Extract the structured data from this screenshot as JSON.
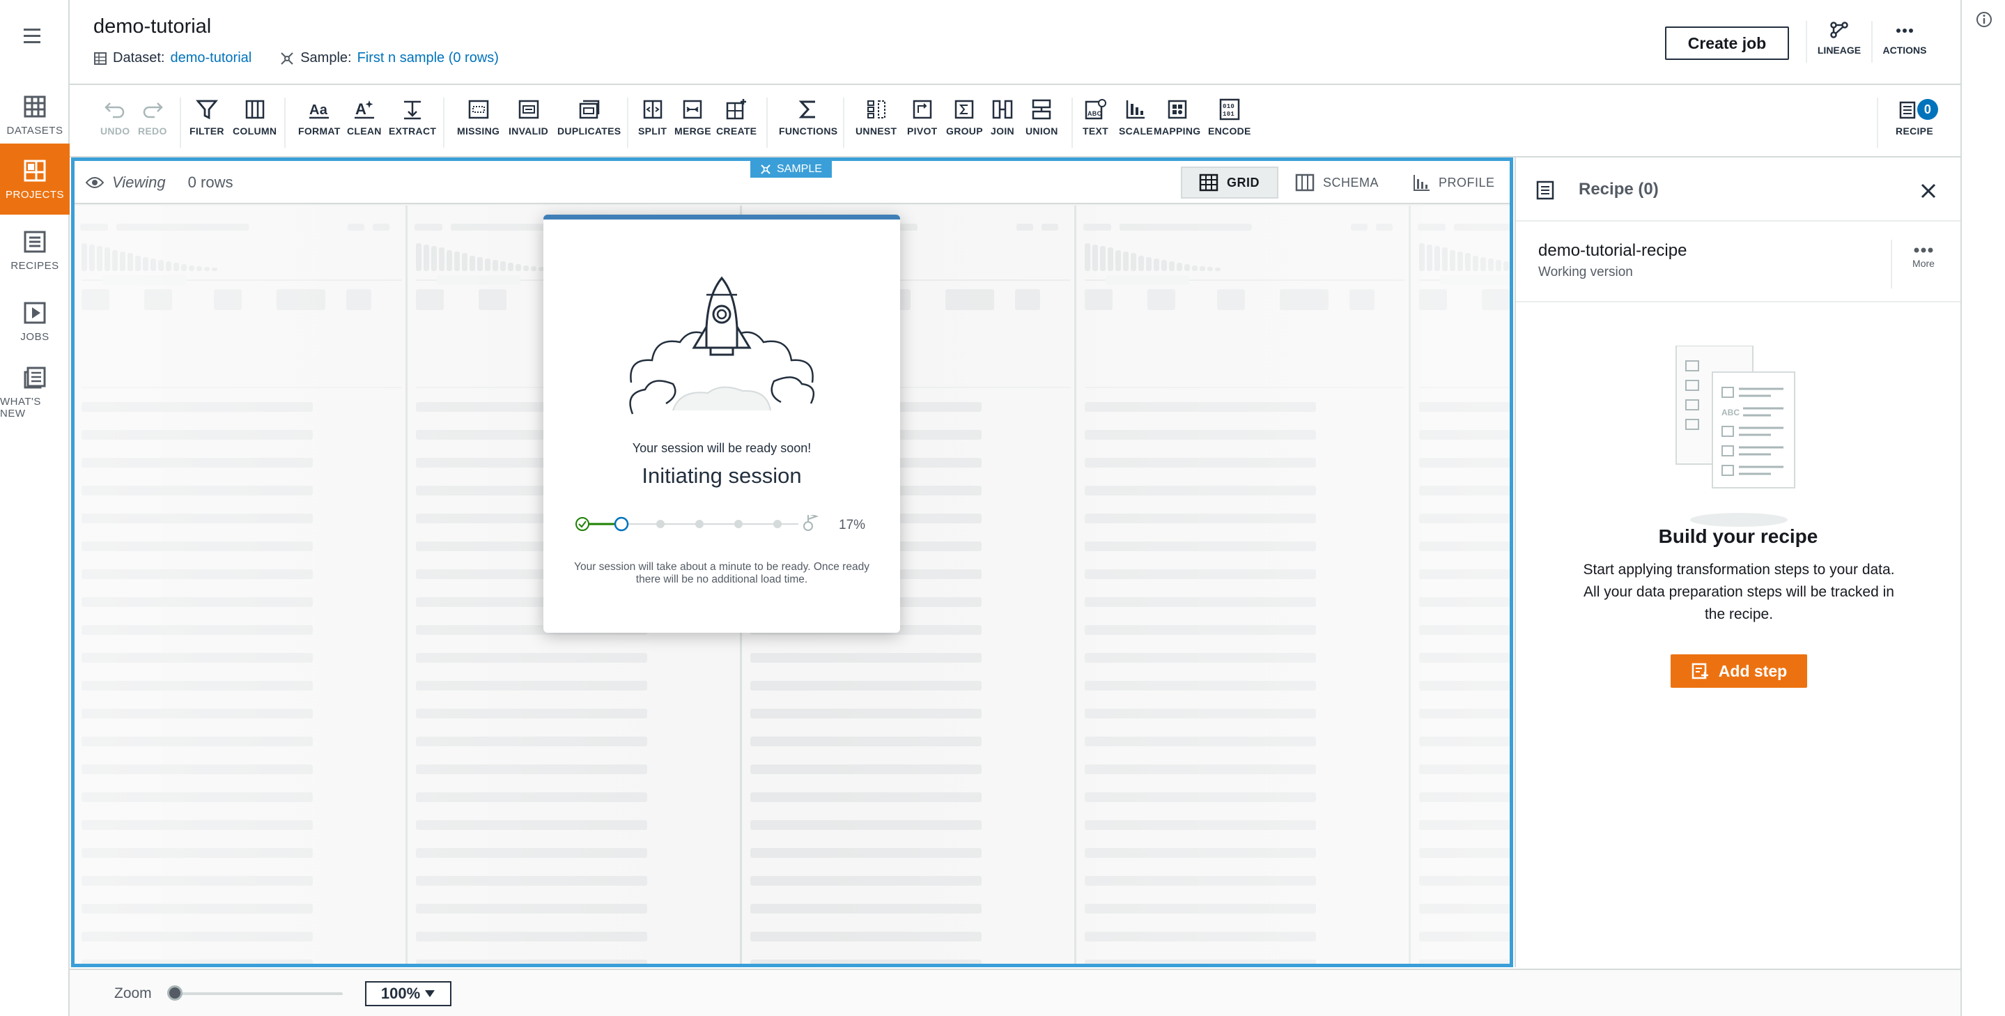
{
  "left_nav": {
    "items": [
      {
        "label": "DATASETS",
        "icon": "table-icon",
        "active": false
      },
      {
        "label": "PROJECTS",
        "icon": "grid-icon",
        "active": true
      },
      {
        "label": "RECIPES",
        "icon": "list-icon",
        "active": false
      },
      {
        "label": "JOBS",
        "icon": "play-icon",
        "active": false
      },
      {
        "label": "WHAT'S NEW",
        "icon": "news-icon",
        "active": false
      }
    ]
  },
  "header": {
    "title": "demo-tutorial",
    "dataset_label": "Dataset:",
    "dataset_value": "demo-tutorial",
    "sample_label": "Sample:",
    "sample_value": "First n sample (0 rows)",
    "create_job": "Create job",
    "lineage": "LINEAGE",
    "actions": "ACTIONS"
  },
  "toolbar": {
    "undo": "UNDO",
    "redo": "REDO",
    "filter": "FILTER",
    "column": "COLUMN",
    "format": "FORMAT",
    "clean": "CLEAN",
    "extract": "EXTRACT",
    "missing": "MISSING",
    "invalid": "INVALID",
    "duplicates": "DUPLICATES",
    "split": "SPLIT",
    "merge": "MERGE",
    "create": "CREATE",
    "functions": "FUNCTIONS",
    "unnest": "UNNEST",
    "pivot": "PIVOT",
    "group": "GROUP",
    "join": "JOIN",
    "union": "UNION",
    "text": "TEXT",
    "scale": "SCALE",
    "mapping": "MAPPING",
    "encode": "ENCODE",
    "recipe": "RECIPE",
    "recipe_count": "0"
  },
  "grid": {
    "viewing": "Viewing",
    "rows": "0 rows",
    "sample_badge": "SAMPLE",
    "tabs": {
      "grid": "GRID",
      "schema": "SCHEMA",
      "profile": "PROFILE"
    }
  },
  "modal": {
    "ready_text": "Your session will be ready soon!",
    "title": "Initiating session",
    "progress_percent": "17%",
    "progress": 0.17,
    "note": "Your session will take about a minute to be ready. Once ready there will be no additional load time."
  },
  "recipe_panel": {
    "title": "Recipe (0)",
    "recipe_name": "demo-tutorial-recipe",
    "version": "Working version",
    "more": "More",
    "heading": "Build your recipe",
    "body": "Start applying transformation steps to your data. All your data preparation steps will be tracked in the recipe.",
    "add_step": "Add step"
  },
  "footer": {
    "zoom_label": "Zoom",
    "zoom_value": "100%"
  },
  "colors": {
    "accent": "#ec7211",
    "link": "#0073bb",
    "grid_border": "#3a9fd8",
    "modal_top": "#3f7fb8",
    "progress_done": "#1d8102"
  }
}
